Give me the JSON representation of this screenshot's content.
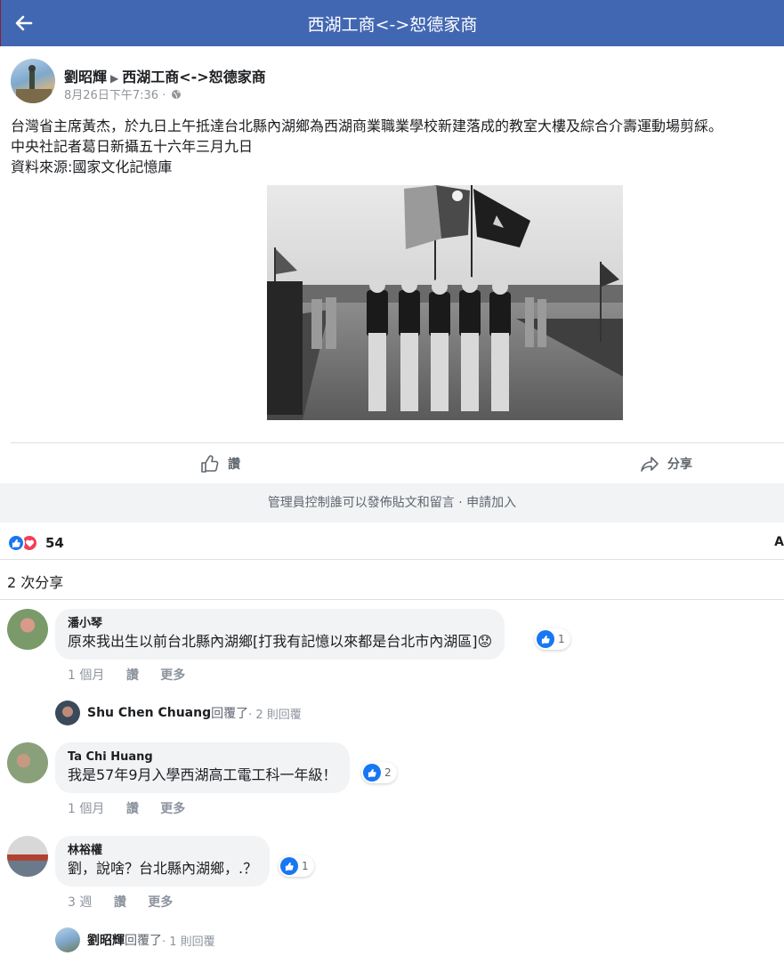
{
  "header": {
    "title": "西湖工商<->恕德家商",
    "back_icon": "back-arrow-icon",
    "color": "#4267b2"
  },
  "post": {
    "author": "劉昭輝",
    "group": "西湖工商<->恕德家商",
    "timestamp": "8月26日下午7:36 ·",
    "privacy_icon": "globe-icon",
    "text_lines": [
      "台灣省主席黃杰，於九日上午抵達台北縣內湖鄉為西湖商業職業學校新建落成的教室大樓及綜合介壽運動場剪綵。",
      "中央社記者葛日新攝五十六年三月九日",
      "資料來源:國家文化記憶庫"
    ],
    "photo_icon": "black-white-photo-parade"
  },
  "actions": {
    "like_label": "讚",
    "share_label": "分享"
  },
  "notice": "管理員控制誰可以發佈貼文和留言 · 申請加入",
  "reactions": {
    "count": "54",
    "edge_char": "A"
  },
  "shares": "2 次分享",
  "comments": [
    {
      "name": "潘小琴",
      "text": "原來我出生以前台北縣內湖鄉[打我有記憶以來都是台北市內湖區]😟",
      "likes": "1",
      "time": "1 個月",
      "like_action": "讚",
      "more": "更多"
    },
    {
      "name": "Ta Chi Huang",
      "text": "我是57年9月入學西湖高工電工科一年級！",
      "likes": "2",
      "time": "1 個月",
      "like_action": "讚",
      "more": "更多"
    },
    {
      "name": "林裕權",
      "text": "劉，說啥？台北縣內湖鄉，.？",
      "likes": "1",
      "time": "3 週",
      "like_action": "讚",
      "more": "更多"
    }
  ],
  "replies": [
    {
      "name": "Shu Chen Chuang",
      "verb": " 回覆了",
      "count": " · 2 則回覆"
    },
    {
      "name": "劉昭輝",
      "verb": "回覆了",
      "count": " · 1 則回覆"
    }
  ]
}
